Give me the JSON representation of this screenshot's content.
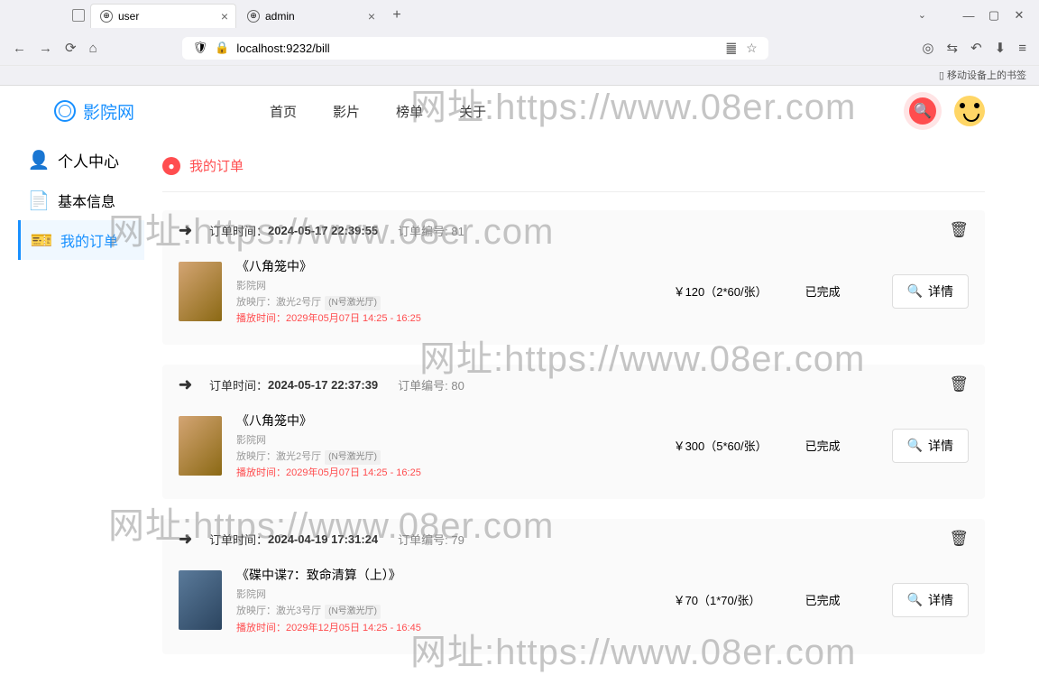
{
  "browser": {
    "tab1": "user",
    "tab2": "admin",
    "url": "localhost:9232/bill",
    "bookmark_label": "移动设备上的书签"
  },
  "header": {
    "logo": "影院网",
    "nav": {
      "home": "首页",
      "films": "影片",
      "ranking": "榜单",
      "about": "关于"
    }
  },
  "sidebar": {
    "title": "个人中心",
    "basic": "基本信息",
    "orders": "我的订单"
  },
  "section": {
    "title": "我的订单"
  },
  "orders": [
    {
      "time_label": "订单时间：",
      "time": "2024-05-17 22:39:55",
      "id_label": "订单编号: ",
      "id": "81",
      "title": "《八角笼中》",
      "cinema": "影院网",
      "hall_label": "放映厅：",
      "hall": "激光2号厅",
      "hall_tag": "(N号激光厅)",
      "playtime_label": "播放时间：",
      "playtime": "2029年05月07日 14:25 - 16:25",
      "price": "￥120（2*60/张）",
      "status": "已完成",
      "detail": "详情"
    },
    {
      "time_label": "订单时间：",
      "time": "2024-05-17 22:37:39",
      "id_label": "订单编号: ",
      "id": "80",
      "title": "《八角笼中》",
      "cinema": "影院网",
      "hall_label": "放映厅：",
      "hall": "激光2号厅",
      "hall_tag": "(N号激光厅)",
      "playtime_label": "播放时间：",
      "playtime": "2029年05月07日 14:25 - 16:25",
      "price": "￥300（5*60/张）",
      "status": "已完成",
      "detail": "详情"
    },
    {
      "time_label": "订单时间：",
      "time": "2024-04-19 17:31:24",
      "id_label": "订单编号: ",
      "id": "79",
      "title": "《碟中谍7：致命清算（上）》",
      "cinema": "影院网",
      "hall_label": "放映厅：",
      "hall": "激光3号厅",
      "hall_tag": "(N号激光厅)",
      "playtime_label": "播放时间：",
      "playtime": "2029年12月05日 14:25 - 16:45",
      "price": "￥70（1*70/张）",
      "status": "已完成",
      "detail": "详情"
    }
  ],
  "watermark": "网址:https://www.08er.com"
}
